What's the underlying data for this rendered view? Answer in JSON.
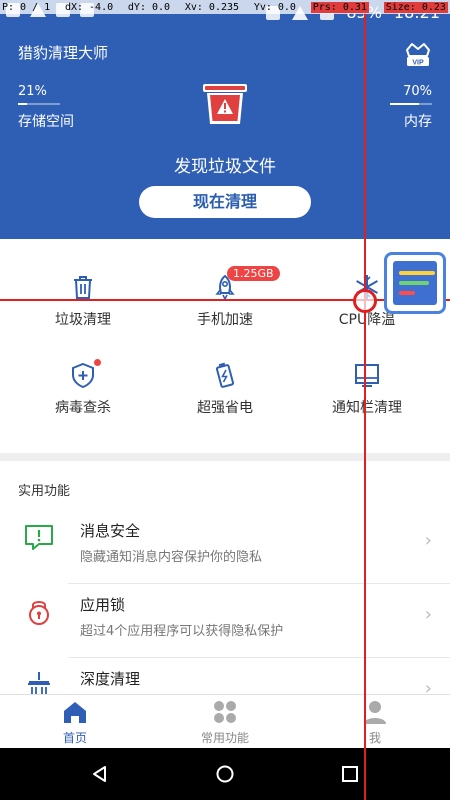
{
  "debug": {
    "p": "P: 0 / 1",
    "dx": "dX: -4.0",
    "dy": "dY: 0.0",
    "xv": "Xv: 0.235",
    "yv": "Yv: 0.0",
    "prs": "Prs: 0.31",
    "size": "Size: 0.23"
  },
  "status": {
    "battery": "85%",
    "time": "18:21"
  },
  "header": {
    "app_title": "猎豹清理大师",
    "vip_label": "VIP",
    "storage_percent": "21%",
    "storage_fill": 0.21,
    "storage_label": "存储空间",
    "memory_percent": "70%",
    "memory_fill": 0.7,
    "memory_label": "内存",
    "headline": "发现垃圾文件",
    "clean_button": "现在清理"
  },
  "features": [
    {
      "label": "垃圾清理",
      "icon": "trash-icon"
    },
    {
      "label": "手机加速",
      "icon": "rocket-icon",
      "badge": "1.25GB"
    },
    {
      "label": "CPU降温",
      "icon": "snowflake-icon"
    },
    {
      "label": "病毒查杀",
      "icon": "shield-icon"
    },
    {
      "label": "超强省电",
      "icon": "battery-icon"
    },
    {
      "label": "通知栏清理",
      "icon": "notification-bar-icon"
    }
  ],
  "practical": {
    "title": "实用功能",
    "items": [
      {
        "title": "消息安全",
        "subtitle": "隐藏通知消息内容保护你的隐私",
        "icon": "message-shield-icon"
      },
      {
        "title": "应用锁",
        "subtitle": "超过4个应用程序可以获得隐私保护",
        "icon": "lock-icon"
      },
      {
        "title": "深度清理",
        "subtitle": "",
        "icon": "deep-clean-icon"
      }
    ]
  },
  "bottom_nav": [
    {
      "label": "首页",
      "icon": "home-icon",
      "active": true
    },
    {
      "label": "常用功能",
      "icon": "apps-icon",
      "active": false
    },
    {
      "label": "我",
      "icon": "profile-icon",
      "active": false
    }
  ],
  "colors": {
    "brand": "#2f5fb5",
    "alert": "#e44444",
    "trash": "#e04040"
  }
}
